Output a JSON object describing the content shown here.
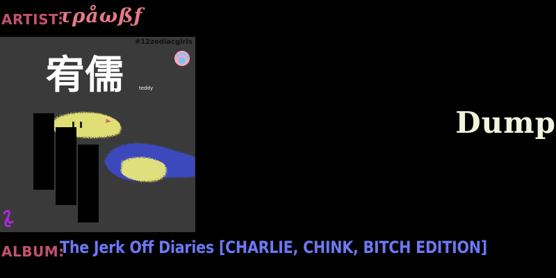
{
  "artist": {
    "label": "ARTIST:",
    "name": "τρåωßƒ"
  },
  "album": {
    "label": "ALBUM:",
    "title": "The Jerk Off Diaries [CHARLIE, CHINK, BITCH EDITION]",
    "art": {
      "hashtag": "#12zodiacgirls",
      "title": "宥儒",
      "subtitle": "teddy"
    }
  },
  "track": {
    "title": "Dump"
  },
  "colors": {
    "background": "#000000",
    "label": "#c2526e",
    "artist_name": "#e67a88",
    "album_title": "#6c78f2",
    "track_title": "#f2f3dc",
    "art_background": "#3a3a3a",
    "snake_yellow": "#e8e87a",
    "snake_blue": "#3c4ccc"
  },
  "icons": [
    "paw-badge-icon",
    "signature-glyph-icon"
  ]
}
